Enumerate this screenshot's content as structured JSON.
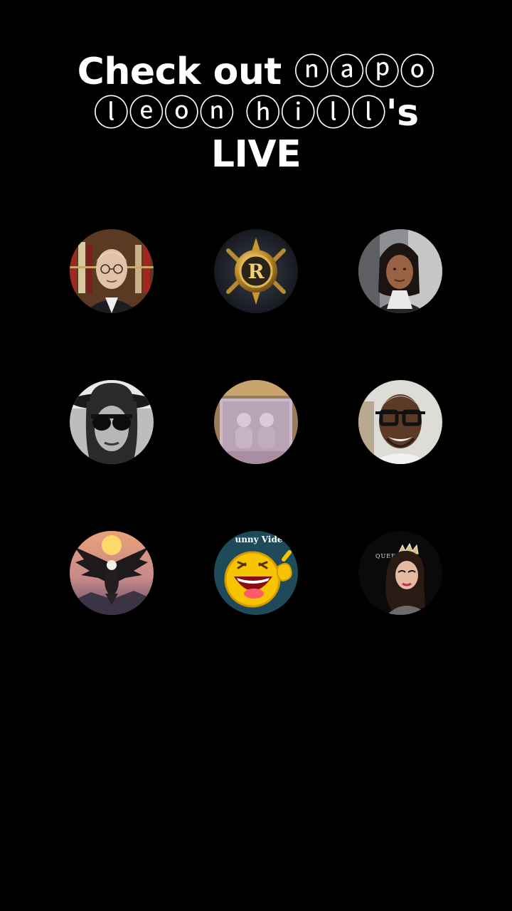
{
  "title": {
    "line1_text": "Check out ",
    "line1_handle": "ⓝⓐⓟⓞ",
    "line2_handle": "ⓛⓔⓞⓝ ⓗⓘⓛⓛ",
    "line2_suffix": "'s",
    "line3": "LIVE"
  },
  "avatars": [
    {
      "subject": "elderly-man-portrait"
    },
    {
      "subject": "gold-emblem-r"
    },
    {
      "subject": "woman-selfie"
    },
    {
      "subject": "woman-hat-sunglasses"
    },
    {
      "subject": "old-photo-children"
    },
    {
      "subject": "bald-man-glasses"
    },
    {
      "subject": "eagle-sunset"
    },
    {
      "subject": "laughing-emoji",
      "text": "unny Vide"
    },
    {
      "subject": "queen-crown-illustration",
      "text": "QUEEN"
    }
  ]
}
